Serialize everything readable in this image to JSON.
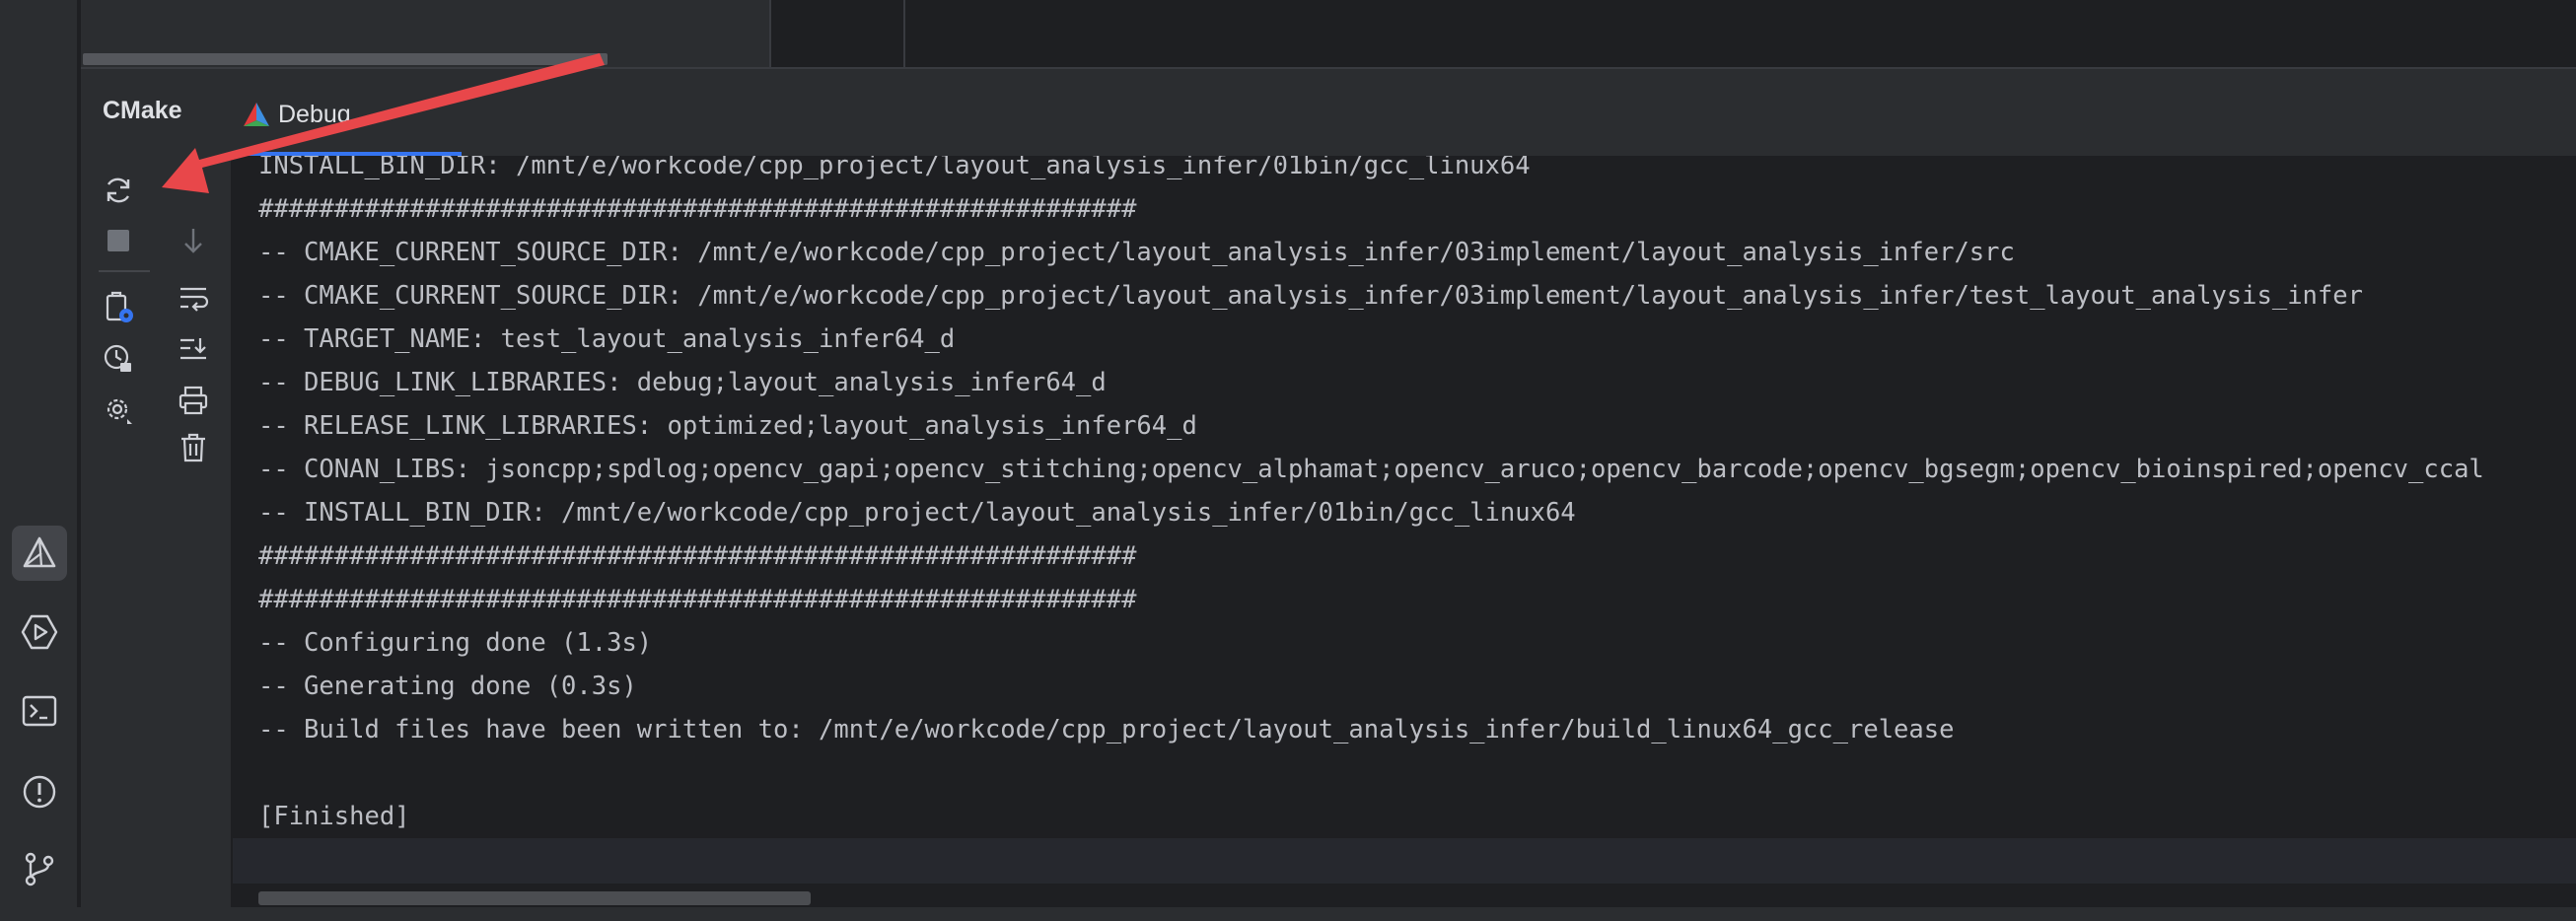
{
  "tool_window": {
    "title": "CMake",
    "tabs": [
      {
        "label": "Debug",
        "icon": "cmake-triangle-icon"
      }
    ]
  },
  "activity_bar": {
    "icons": [
      "cmake-icon",
      "run-icon",
      "terminal-icon",
      "problems-icon",
      "git-icon"
    ],
    "active": "cmake-icon"
  },
  "toolbar": {
    "icons": [
      "reload-icon",
      "stop-icon",
      "scroll-down-icon",
      "soft-wrap-icon",
      "scroll-to-end-icon",
      "cmake-settings-icon",
      "clock-lock-icon",
      "print-icon",
      "gear-icon",
      "trash-icon"
    ]
  },
  "console": {
    "lines": [
      "INSTALL_BIN_DIR: /mnt/e/workcode/cpp_project/layout_analysis_infer/01bin/gcc_linux64",
      "##########################################################",
      "-- CMAKE_CURRENT_SOURCE_DIR: /mnt/e/workcode/cpp_project/layout_analysis_infer/03implement/layout_analysis_infer/src",
      "-- CMAKE_CURRENT_SOURCE_DIR: /mnt/e/workcode/cpp_project/layout_analysis_infer/03implement/layout_analysis_infer/test_layout_analysis_infer",
      "-- TARGET_NAME: test_layout_analysis_infer64_d",
      "-- DEBUG_LINK_LIBRARIES: debug;layout_analysis_infer64_d",
      "-- RELEASE_LINK_LIBRARIES: optimized;layout_analysis_infer64_d",
      "-- CONAN_LIBS: jsoncpp;spdlog;opencv_gapi;opencv_stitching;opencv_alphamat;opencv_aruco;opencv_barcode;opencv_bgsegm;opencv_bioinspired;opencv_ccal",
      "-- INSTALL_BIN_DIR: /mnt/e/workcode/cpp_project/layout_analysis_infer/01bin/gcc_linux64",
      "##########################################################",
      "##########################################################",
      "-- Configuring done (1.3s)",
      "-- Generating done (0.3s)",
      "-- Build files have been written to: /mnt/e/workcode/cpp_project/layout_analysis_infer/build_linux64_gcc_release",
      "",
      "[Finished]"
    ]
  },
  "colors": {
    "background": "#1e1f22",
    "panel": "#2b2d30",
    "text": "#bcbec4",
    "accent": "#3574f0",
    "annotation_arrow": "#e8474a"
  }
}
